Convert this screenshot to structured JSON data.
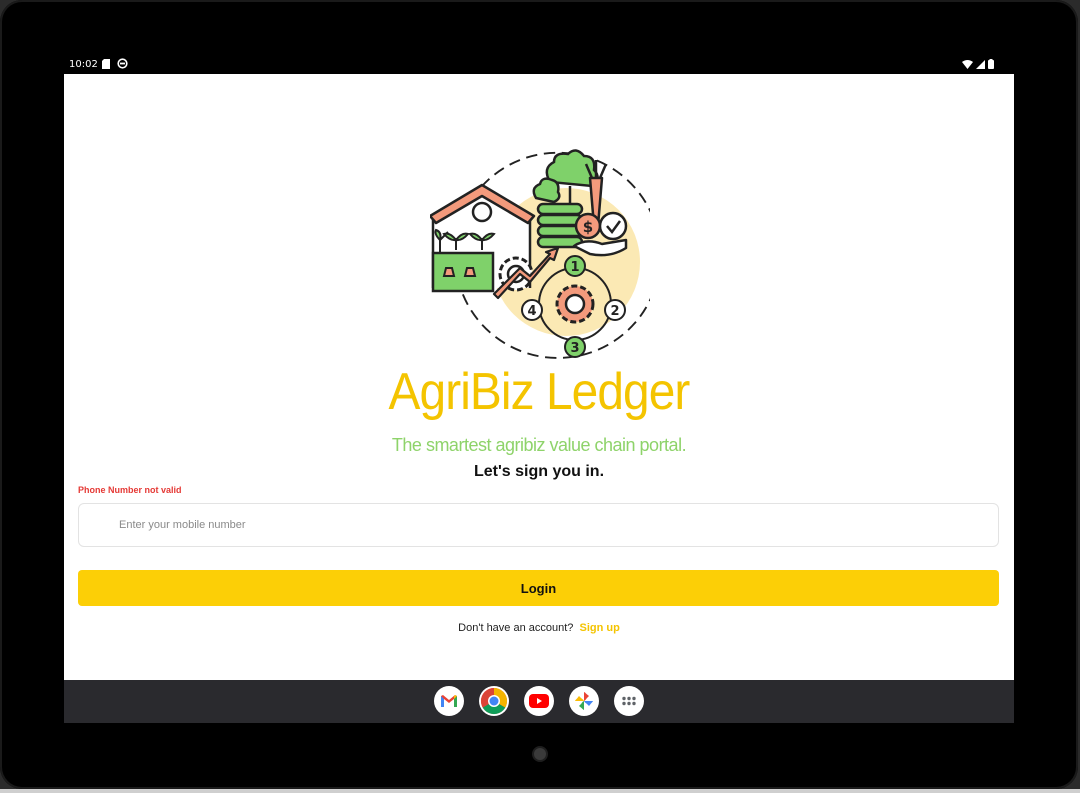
{
  "status_bar": {
    "time": "10:02",
    "left_icons": [
      "sim-card-icon",
      "vpn-icon"
    ],
    "right_icons": [
      "wifi-icon",
      "signal-icon",
      "battery-icon"
    ]
  },
  "app": {
    "brand_name": "AgriBiz Ledger",
    "tagline": "The smartest agribiz value chain portal.",
    "heading": "Let's sign you in.",
    "phone_error": "Phone Number not valid",
    "phone_placeholder": "Enter your mobile number",
    "phone_value": "",
    "login_label": "Login",
    "signup_prompt": "Don't have an account?",
    "signup_link": "Sign up",
    "logo_steps": [
      "1",
      "2",
      "3",
      "4"
    ],
    "logo_currency": "$"
  },
  "taskbar": {
    "apps": [
      "gmail-icon",
      "chrome-icon",
      "youtube-icon",
      "photos-icon",
      "app-drawer-icon"
    ]
  },
  "colors": {
    "brand": "#f4c400",
    "button": "#fccf06",
    "tagline": "#8ed36a",
    "error": "#e53935",
    "taskbar": "#2a2a2e"
  }
}
